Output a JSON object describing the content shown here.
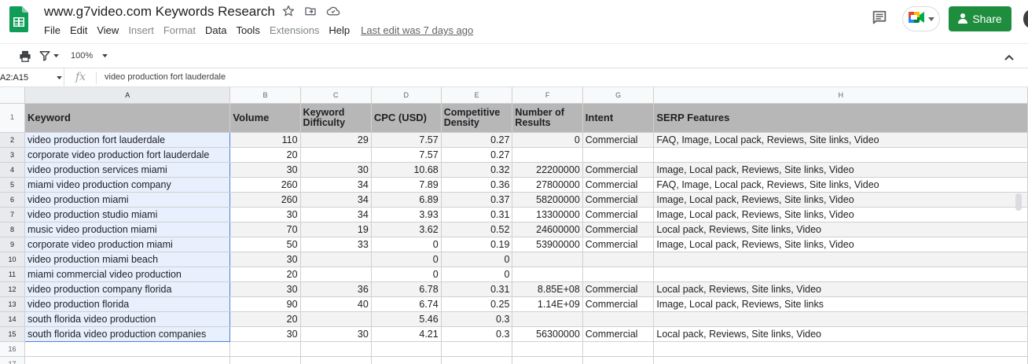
{
  "app": {
    "title": "www.g7video.com Keywords Research",
    "menu": [
      "File",
      "Edit",
      "View",
      "Insert",
      "Format",
      "Data",
      "Tools",
      "Extensions",
      "Help"
    ],
    "menu_dim": [
      "Insert",
      "Format",
      "Extensions"
    ],
    "last_edit": "Last edit was 7 days ago",
    "share_label": "Share",
    "icons": {
      "logo": "google-sheets-logo",
      "star": "star-icon",
      "move": "folder-move-icon",
      "cloud": "cloud-status-icon",
      "comments": "comment-icon",
      "meet": "google-meet-icon",
      "lock": "lock-icon"
    },
    "colors": {
      "share": "#1e8e3e",
      "header_row": "#b7b7b7",
      "selection": "#e8f0fe",
      "selection_border": "#4a7fe0"
    }
  },
  "toolbar": {
    "zoom": "100%"
  },
  "formula_bar": {
    "name_box": "A2:A15",
    "fx_label": "fx",
    "value": "video production fort lauderdale"
  },
  "sheet": {
    "columns": [
      "A",
      "B",
      "C",
      "D",
      "E",
      "F",
      "G",
      "H"
    ],
    "header_row_number": "1",
    "headers": [
      "Keyword",
      "Volume",
      "Keyword Difficulty",
      "CPC (USD)",
      "Competitive Density",
      "Number of Results",
      "Intent",
      "SERP Features"
    ],
    "rows": [
      {
        "n": "2",
        "cells": [
          "video production fort lauderdale",
          "110",
          "29",
          "7.57",
          "0.27",
          "0",
          "Commercial",
          "FAQ, Image, Local pack, Reviews, Site links, Video"
        ]
      },
      {
        "n": "3",
        "cells": [
          "corporate video production fort lauderdale",
          "20",
          "",
          "7.57",
          "0.27",
          "",
          "",
          ""
        ]
      },
      {
        "n": "4",
        "cells": [
          "video production services miami",
          "30",
          "30",
          "10.68",
          "0.32",
          "22200000",
          "Commercial",
          "Image, Local pack, Reviews, Site links, Video"
        ]
      },
      {
        "n": "5",
        "cells": [
          "miami video production company",
          "260",
          "34",
          "7.89",
          "0.36",
          "27800000",
          "Commercial",
          "FAQ, Image, Local pack, Reviews, Site links, Video"
        ]
      },
      {
        "n": "6",
        "cells": [
          "video production miami",
          "260",
          "34",
          "6.89",
          "0.37",
          "58200000",
          "Commercial",
          "Image, Local pack, Reviews, Site links, Video"
        ]
      },
      {
        "n": "7",
        "cells": [
          "video production studio miami",
          "30",
          "34",
          "3.93",
          "0.31",
          "13300000",
          "Commercial",
          "Image, Local pack, Reviews, Site links, Video"
        ]
      },
      {
        "n": "8",
        "cells": [
          "music video production miami",
          "70",
          "19",
          "3.62",
          "0.52",
          "24600000",
          "Commercial",
          "Local pack, Reviews, Site links, Video"
        ]
      },
      {
        "n": "9",
        "cells": [
          "corporate video production miami",
          "50",
          "33",
          "0",
          "0.19",
          "53900000",
          "Commercial",
          "Image, Local pack, Reviews, Site links, Video"
        ]
      },
      {
        "n": "10",
        "cells": [
          "video production miami beach",
          "30",
          "",
          "0",
          "0",
          "",
          "",
          ""
        ]
      },
      {
        "n": "11",
        "cells": [
          "miami commercial video production",
          "20",
          "",
          "0",
          "0",
          "",
          "",
          ""
        ]
      },
      {
        "n": "12",
        "cells": [
          "video production company florida",
          "30",
          "36",
          "6.78",
          "0.31",
          "8.85E+08",
          "Commercial",
          "Local pack, Reviews, Site links, Video"
        ]
      },
      {
        "n": "13",
        "cells": [
          "video production florida",
          "90",
          "40",
          "6.74",
          "0.25",
          "1.14E+09",
          "Commercial",
          "Image, Local pack, Reviews, Site links"
        ]
      },
      {
        "n": "14",
        "cells": [
          "south florida video production",
          "20",
          "",
          "5.46",
          "0.3",
          "",
          "",
          ""
        ]
      },
      {
        "n": "15",
        "cells": [
          "south florida video production companies",
          "30",
          "30",
          "4.21",
          "0.3",
          "56300000",
          "Commercial",
          "Local pack, Reviews, Site links, Video"
        ]
      }
    ],
    "empty_rows": [
      "16",
      "17"
    ]
  }
}
